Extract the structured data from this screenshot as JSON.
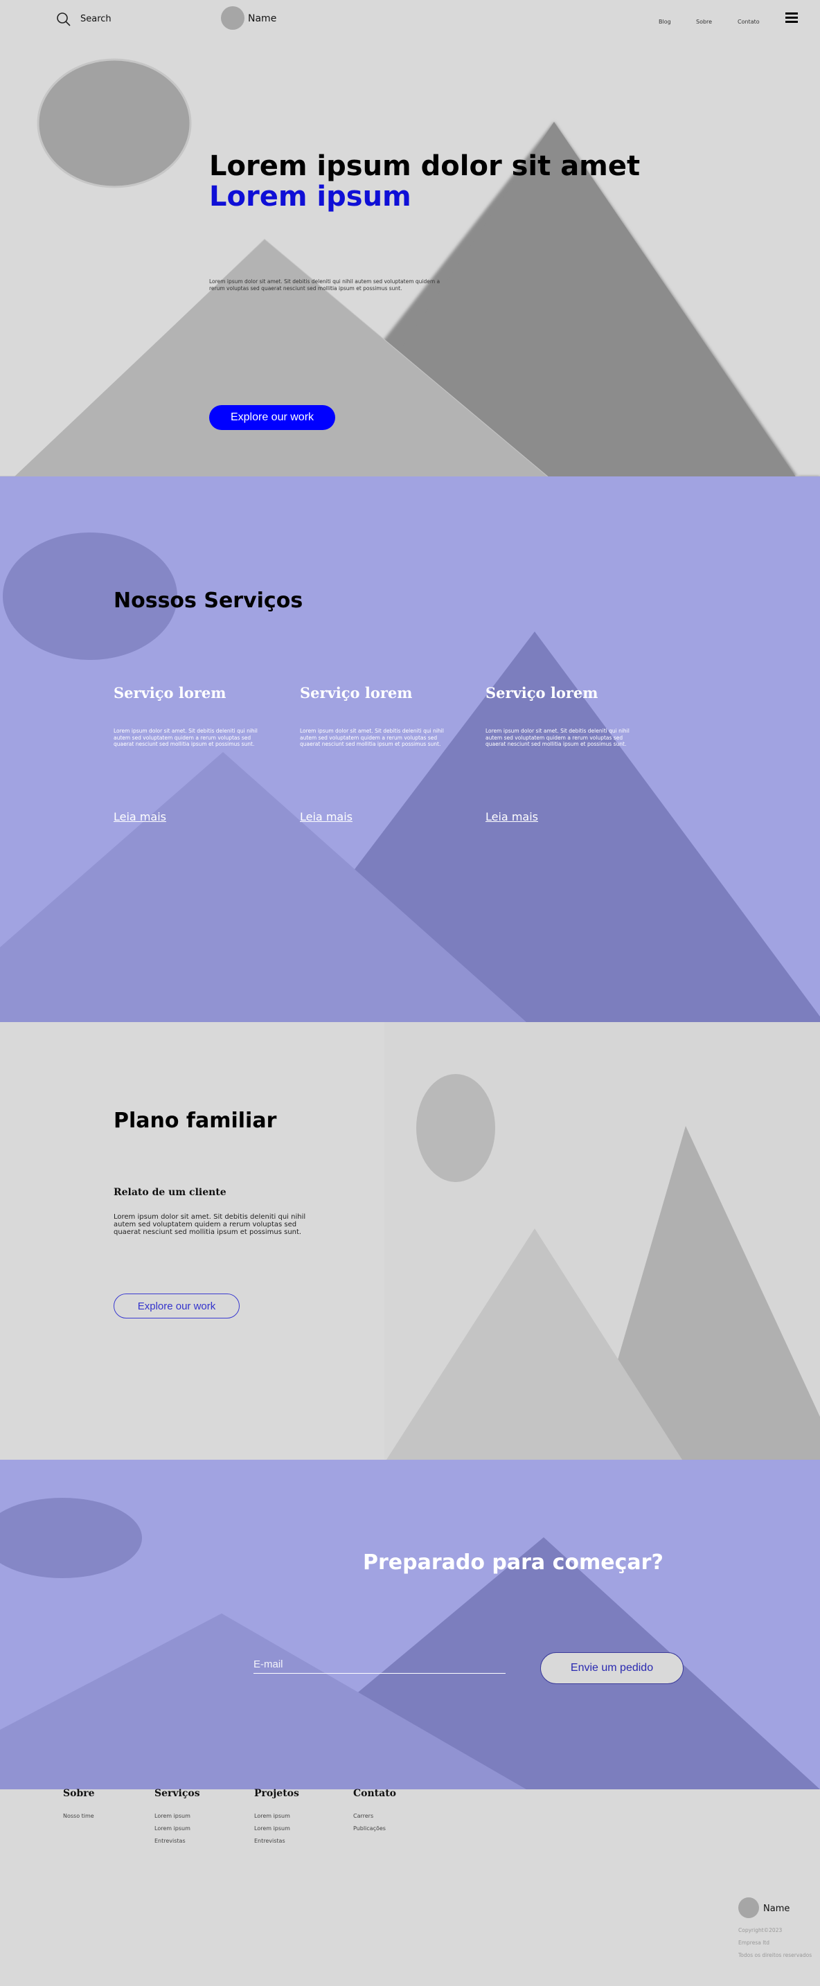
{
  "colors": {
    "page_bg": "#d9d9d9",
    "accent_blue": "#0000ff",
    "section_purple": "#a1a3e1",
    "purple_dark": "#7c7ebe",
    "purple_mid": "#9193d2"
  },
  "header": {
    "search_label": "Search",
    "search_icon": "search-icon",
    "user_name": "Name",
    "nav": [
      "Blog",
      "Sobre",
      "Contato"
    ],
    "menu_icon": "hamburger-menu-icon"
  },
  "hero": {
    "title": "Lorem ipsum dolor sit amet",
    "subtitle": "Lorem ipsum",
    "text": "Lorem ipsum dolor sit amet. Sit debitis deleniti qui nihil autem sed voluptatem quidem a rerum voluptas sed quaerat nesciunt sed mollitia ipsum et possimus sunt.",
    "cta_label": "Explore our work"
  },
  "services": {
    "title": "Nossos Serviços",
    "items": [
      {
        "title": "Serviço lorem",
        "text": "Lorem ipsum dolor sit amet. Sit debitis deleniti qui nihil autem sed voluptatem quidem a rerum voluptas sed quaerat nesciunt sed mollitia ipsum et possimus sunt.",
        "link": "Leia mais"
      },
      {
        "title": "Serviço lorem",
        "text": "Lorem ipsum dolor sit amet. Sit debitis deleniti qui nihil autem sed voluptatem quidem a rerum voluptas sed quaerat nesciunt sed mollitia ipsum et possimus sunt.",
        "link": "Leia mais"
      },
      {
        "title": "Serviço lorem",
        "text": "Lorem ipsum dolor sit amet. Sit debitis deleniti qui nihil autem sed voluptatem quidem a rerum voluptas sed quaerat nesciunt sed mollitia ipsum et possimus sunt.",
        "link": "Leia mais"
      }
    ]
  },
  "family": {
    "title": "Plano familiar",
    "subtitle": "Relato de um cliente",
    "text": "Lorem ipsum dolor sit amet. Sit debitis deleniti qui nihil autem sed voluptatem quidem a rerum voluptas sed quaerat nesciunt sed mollitia ipsum et possimus sunt.",
    "cta_label": "Explore our work"
  },
  "cta": {
    "title": "Preparado para começar?",
    "email_placeholder": "E-mail",
    "button_label": "Envie um pedido"
  },
  "footer": {
    "columns": [
      {
        "title": "Sobre",
        "links": [
          "Nosso time"
        ]
      },
      {
        "title": "Serviços",
        "links": [
          "Lorem ipsum",
          "Lorem ipsum",
          "Entrevistas"
        ]
      },
      {
        "title": "Projetos",
        "links": [
          "Lorem ipsum",
          "Lorem ipsum",
          "Entrevistas"
        ]
      },
      {
        "title": "Contato",
        "links": [
          "Carrers",
          "Publicações"
        ]
      }
    ],
    "user_name": "Name",
    "copyright": "Copyright©2023",
    "company": "Empresa ltd",
    "rights": "Todos os direitos reservados"
  }
}
